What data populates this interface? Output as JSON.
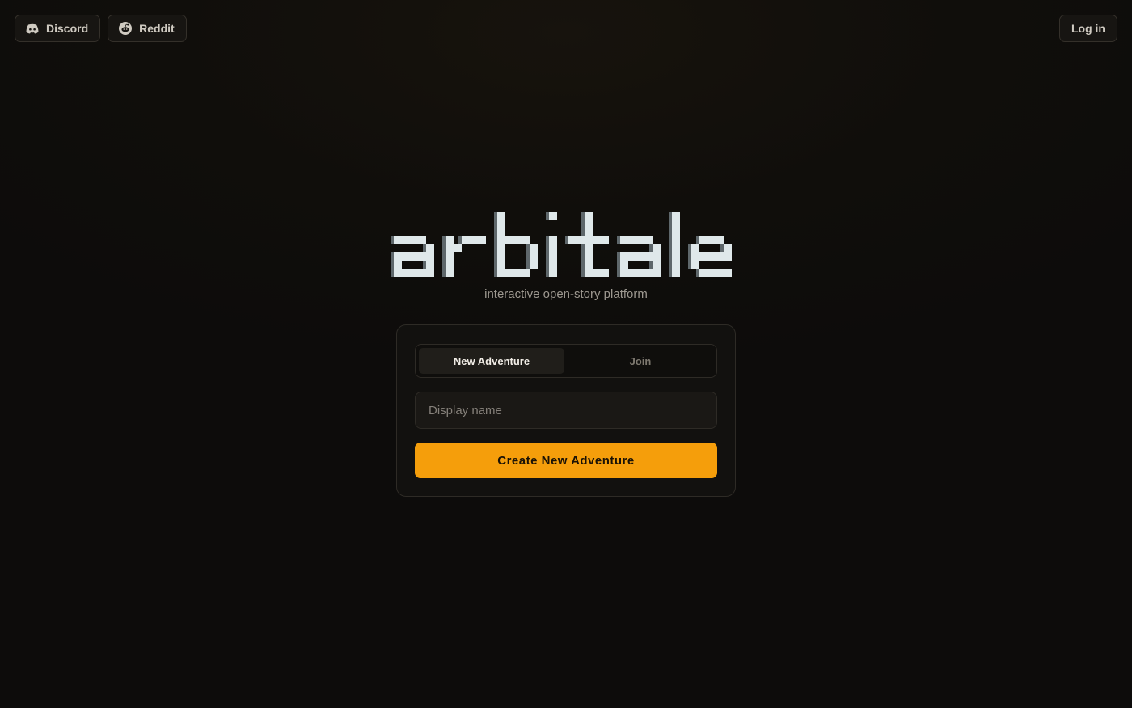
{
  "header": {
    "links": [
      {
        "label": "Discord",
        "icon": "discord-icon"
      },
      {
        "label": "Reddit",
        "icon": "reddit-icon"
      }
    ],
    "login_label": "Log in"
  },
  "brand": {
    "logo_text": "arbitale",
    "tagline": "interactive open-story platform"
  },
  "form": {
    "tabs": [
      {
        "label": "New Adventure",
        "active": true
      },
      {
        "label": "Join",
        "active": false
      }
    ],
    "display_name_placeholder": "Display name",
    "display_name_value": "",
    "submit_label": "Create New Adventure"
  },
  "colors": {
    "accent": "#f59e0b",
    "background": "#0d0c0b",
    "logo_light": "#dfe8ea",
    "logo_shadow": "#5e676b"
  }
}
